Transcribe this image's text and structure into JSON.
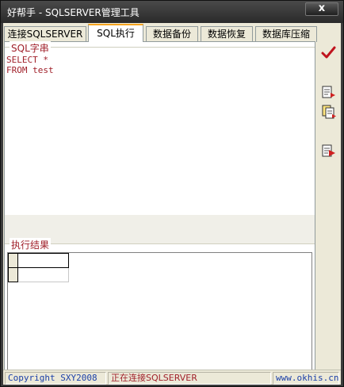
{
  "window": {
    "title": "好帮手 - SQLSERVER管理工具",
    "close_label": "x"
  },
  "tabs": [
    {
      "label": "连接SQLSERVER",
      "active": false
    },
    {
      "label": "SQL执行",
      "active": true
    },
    {
      "label": "数据备份",
      "active": false
    },
    {
      "label": "数据恢复",
      "active": false
    },
    {
      "label": "数据库压缩",
      "active": false
    }
  ],
  "sql_group": {
    "label": "SQL字串",
    "text": "SELECT *\nFROM test"
  },
  "result_group": {
    "label": "执行结果"
  },
  "toolbar": {
    "execute_icon": "checkmark-icon",
    "tool_icons": [
      "document-arrow-icon",
      "document-copy-icon",
      "document-export-icon"
    ]
  },
  "status": {
    "copyright": "Copyright SXY2008",
    "connection": "正在连接SQLSERVER",
    "website": "www.okhis.cn"
  },
  "colors": {
    "accent_text": "#a0202a",
    "status_link": "#1a3fa8",
    "tab_highlight": "#f6a51f"
  }
}
